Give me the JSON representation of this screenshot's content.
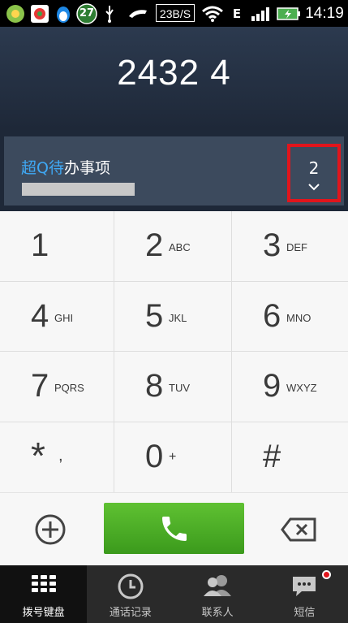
{
  "status_bar": {
    "notification_count": "27",
    "network_speed": "23B/S",
    "time": "14:19"
  },
  "dialer": {
    "dialed_number": "2432 4"
  },
  "suggestion": {
    "name_highlight": "超Q待",
    "name_rest": "办事项",
    "match_count": "2"
  },
  "keypad": {
    "keys": [
      {
        "digit": "1",
        "letters": ""
      },
      {
        "digit": "2",
        "letters": "ABC"
      },
      {
        "digit": "3",
        "letters": "DEF"
      },
      {
        "digit": "4",
        "letters": "GHI"
      },
      {
        "digit": "5",
        "letters": "JKL"
      },
      {
        "digit": "6",
        "letters": "MNO"
      },
      {
        "digit": "7",
        "letters": "PQRS"
      },
      {
        "digit": "8",
        "letters": "TUV"
      },
      {
        "digit": "9",
        "letters": "WXYZ"
      },
      {
        "digit": "*",
        "letters": ","
      },
      {
        "digit": "0",
        "letters": "+"
      },
      {
        "digit": "#",
        "letters": ""
      }
    ]
  },
  "nav": {
    "items": [
      {
        "label": "拨号键盘",
        "icon": "keypad-grid-icon"
      },
      {
        "label": "通话记录",
        "icon": "clock-icon"
      },
      {
        "label": "联系人",
        "icon": "contacts-icon"
      },
      {
        "label": "短信",
        "icon": "message-icon"
      }
    ]
  },
  "colors": {
    "accent_blue": "#3fa9f5",
    "call_green": "#4caf2a",
    "highlight_red": "#e1151c"
  }
}
